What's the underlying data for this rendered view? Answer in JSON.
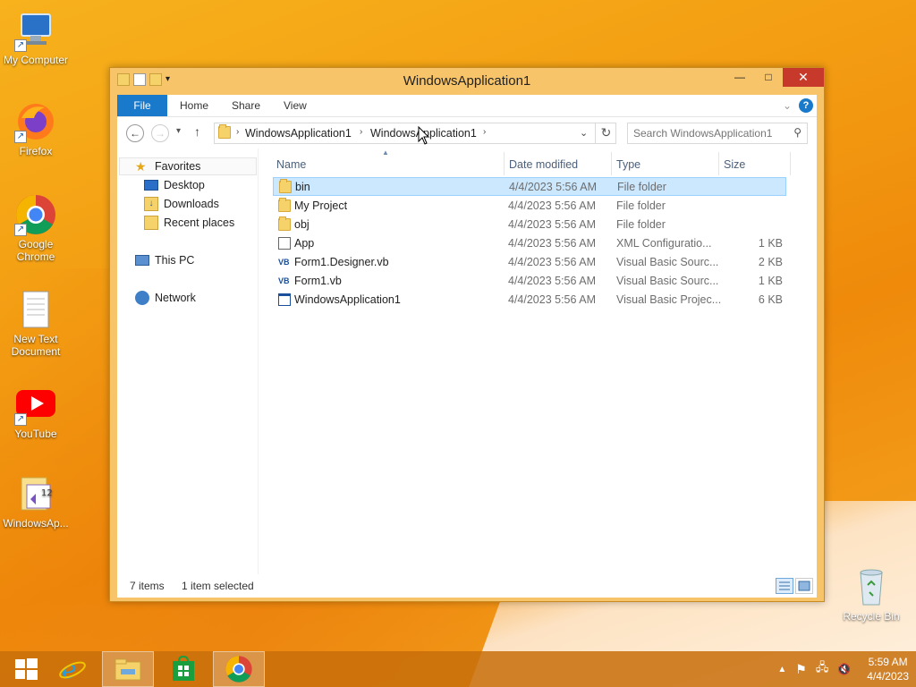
{
  "desktop": {
    "icons": [
      {
        "label": "My Computer"
      },
      {
        "label": "Firefox"
      },
      {
        "label": "Google Chrome"
      },
      {
        "label": "New Text Document"
      },
      {
        "label": "YouTube"
      },
      {
        "label": "WindowsAp..."
      },
      {
        "label": "Recycle Bin"
      }
    ]
  },
  "window": {
    "title": "WindowsApplication1",
    "controls": {
      "minimize": "—",
      "maximize": "□",
      "close": "✕"
    },
    "ribbon": {
      "tabs": [
        {
          "label": "File"
        },
        {
          "label": "Home"
        },
        {
          "label": "Share"
        },
        {
          "label": "View"
        }
      ]
    },
    "address": {
      "segments": [
        "WindowsApplication1",
        "WindowsApplication1"
      ],
      "search_placeholder": "Search WindowsApplication1"
    },
    "nav_pane": {
      "favorites": "Favorites",
      "items": [
        {
          "label": "Desktop"
        },
        {
          "label": "Downloads"
        },
        {
          "label": "Recent places"
        }
      ],
      "this_pc": "This PC",
      "network": "Network"
    },
    "columns": {
      "name": "Name",
      "date": "Date modified",
      "type": "Type",
      "size": "Size"
    },
    "files": [
      {
        "name": "bin",
        "date": "4/4/2023 5:56 AM",
        "type": "File folder",
        "size": "",
        "icon": "folder-icon",
        "selected": true
      },
      {
        "name": "My Project",
        "date": "4/4/2023 5:56 AM",
        "type": "File folder",
        "size": "",
        "icon": "folder-icon"
      },
      {
        "name": "obj",
        "date": "4/4/2023 5:56 AM",
        "type": "File folder",
        "size": "",
        "icon": "folder-icon"
      },
      {
        "name": "App",
        "date": "4/4/2023 5:56 AM",
        "type": "XML Configuratio...",
        "size": "1 KB",
        "icon": "config-file-icon"
      },
      {
        "name": "Form1.Designer.vb",
        "date": "4/4/2023 5:56 AM",
        "type": "Visual Basic Sourc...",
        "size": "2 KB",
        "icon": "vb-file-icon"
      },
      {
        "name": "Form1.vb",
        "date": "4/4/2023 5:56 AM",
        "type": "Visual Basic Sourc...",
        "size": "1 KB",
        "icon": "vb-file-icon"
      },
      {
        "name": "WindowsApplication1",
        "date": "4/4/2023 5:56 AM",
        "type": "Visual Basic Projec...",
        "size": "6 KB",
        "icon": "vb-project-icon"
      }
    ],
    "status": {
      "items": "7 items",
      "selected": "1 item selected"
    }
  },
  "taskbar": {
    "time": "5:59 AM",
    "date": "4/4/2023"
  }
}
